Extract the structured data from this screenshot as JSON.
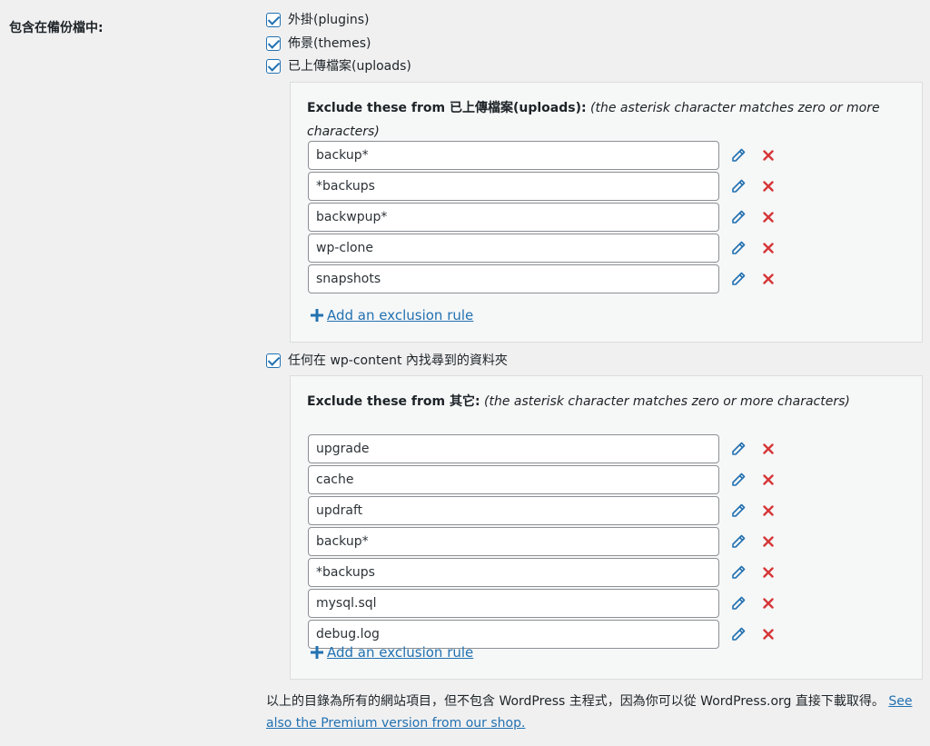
{
  "section_label": "包含在備份檔中:",
  "checkboxes": {
    "plugins": "外掛(plugins)",
    "themes": "佈景(themes)",
    "uploads": "已上傳檔案(uploads)",
    "others": "任何在 wp-content 內找尋到的資料夾"
  },
  "uploads_panel": {
    "heading_bold": "Exclude these from 已上傳檔案(uploads):",
    "heading_italic": "(the asterisk character matches zero or more characters)",
    "rules": [
      "backup*",
      "*backups",
      "backwpup*",
      "wp-clone",
      "snapshots"
    ],
    "add_label": "Add an exclusion rule"
  },
  "others_panel": {
    "heading_bold": "Exclude these from 其它:",
    "heading_italic": "(the asterisk character matches zero or more characters)",
    "rules": [
      "upgrade",
      "cache",
      "updraft",
      "backup*",
      "*backups",
      "mysql.sql",
      "debug.log"
    ],
    "add_label": "Add an exclusion rule"
  },
  "footer": {
    "text": "以上的目錄為所有的網站項目，但不包含 WordPress 主程式，因為你可以從 WordPress.org 直接下載取得。",
    "link": "See also the Premium version from our shop."
  },
  "colors": {
    "accent": "#2271b1",
    "delete": "#d63638",
    "panel_bg": "#f6f7f7"
  },
  "icons": {
    "edit": "pencil-icon",
    "delete": "close-icon",
    "add": "plus-icon",
    "check": "checkmark-icon"
  }
}
